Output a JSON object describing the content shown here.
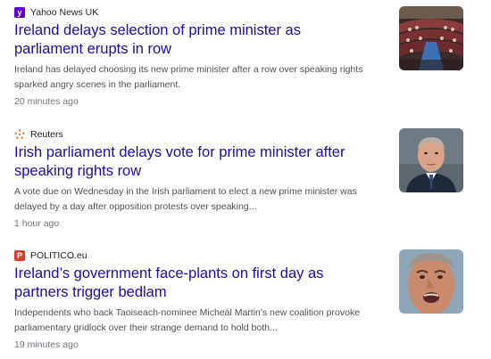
{
  "articles": [
    {
      "source": "Yahoo News UK",
      "logo_glyph": "y",
      "logo_color": "#6001d2",
      "headline": "Ireland delays selection of prime minister as parliament erupts in row",
      "snippet": "Ireland has delayed choosing its new prime minister after a row over speaking rights sparked angry scenes in the parliament.",
      "time": "20 minutes ago",
      "thumbnail": "parliament-chamber-photo"
    },
    {
      "source": "Reuters",
      "logo_glyph": "reuters-dots-icon",
      "logo_color": "#fa6400",
      "headline": "Irish parliament delays vote for prime minister after speaking rights row",
      "snippet": "A vote due on Wednesday in the Irish parliament to elect a new prime minister was delayed by a day after opposition protests over speaking...",
      "time": "1 hour ago",
      "thumbnail": "politician-portrait-photo"
    },
    {
      "source": "POLITICO.eu",
      "logo_glyph": "P",
      "logo_color": "#dc3c2e",
      "headline": "Ireland’s government face-plants on first day as partners trigger bedlam",
      "snippet": "Independents who back Taoiseach-nominee Micheál Martin's new coalition provoke parliamentary gridlock over their strange demand to hold both...",
      "time": "19 minutes ago",
      "thumbnail": "politician-speaking-photo"
    }
  ]
}
